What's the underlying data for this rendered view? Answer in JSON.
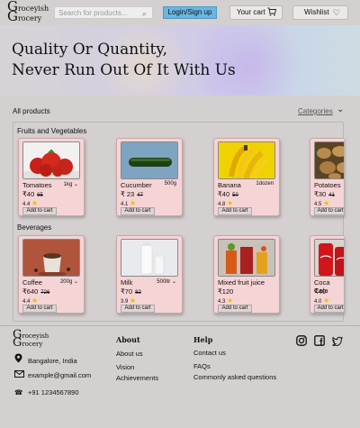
{
  "header": {
    "logo_line1": "Groceyish",
    "logo_line2": "rocery",
    "search_placeholder": "Search for products...",
    "login_label": "Login/Sign up",
    "cart_label": "Your cart",
    "wishlist_label": "Wishlist"
  },
  "hero": {
    "line1": "Quality Or Quantity,",
    "line2": "Never Run Out Of It With Us"
  },
  "products": {
    "all_label": "All products",
    "categories_label": "Categories",
    "sections": [
      {
        "title": "Fruits and Vegetables",
        "items": [
          {
            "name": "Tomatoes",
            "qty": "1kg",
            "price": "₹40",
            "mrp": "65",
            "rating": "4.4",
            "add": "Add to cart"
          },
          {
            "name": "Cucumber",
            "qty": "500g",
            "price": "₹ 23",
            "mrp": "47",
            "rating": "4.1",
            "add": "Add to cart"
          },
          {
            "name": "Banana",
            "qty": "1dozen",
            "price": "₹40",
            "mrp": "50",
            "rating": "4.8",
            "add": "Add to cart"
          },
          {
            "name": "Potatoes",
            "qty": "",
            "price": "₹30",
            "mrp": "41",
            "rating": "4.5",
            "add": "Add to cart"
          }
        ]
      },
      {
        "title": "Beverages",
        "items": [
          {
            "name": "Coffee",
            "qty": "200g",
            "price": "₹640",
            "mrp": "726",
            "rating": "4.4",
            "add": "Add to cart"
          },
          {
            "name": "Milk",
            "qty": "500ltr",
            "price": "₹70",
            "mrp": "82",
            "rating": "3.9",
            "add": "Add to cart"
          },
          {
            "name": "Mixed fruit juice",
            "qty": "",
            "price": "₹120",
            "mrp": "",
            "rating": "4.3",
            "add": "Add to cart"
          },
          {
            "name": "Coca Cola",
            "qty": "",
            "price": "₹40",
            "mrp": "",
            "rating": "4.0",
            "add": "Add to cart"
          }
        ]
      }
    ]
  },
  "footer": {
    "logo_line1": "Groceyish",
    "logo_line2": "rocery",
    "address": "Bangalore, India",
    "email": "example@gmail.com",
    "phone": "+91 1234567890",
    "about_title": "About",
    "about_links": [
      "About us",
      "Vision",
      "Achievements"
    ],
    "help_title": "Help",
    "help_links": [
      "Contact us",
      "FAQs",
      "Commonly asked questions"
    ],
    "social": [
      "instagram-icon",
      "facebook-icon",
      "twitter-icon"
    ]
  }
}
